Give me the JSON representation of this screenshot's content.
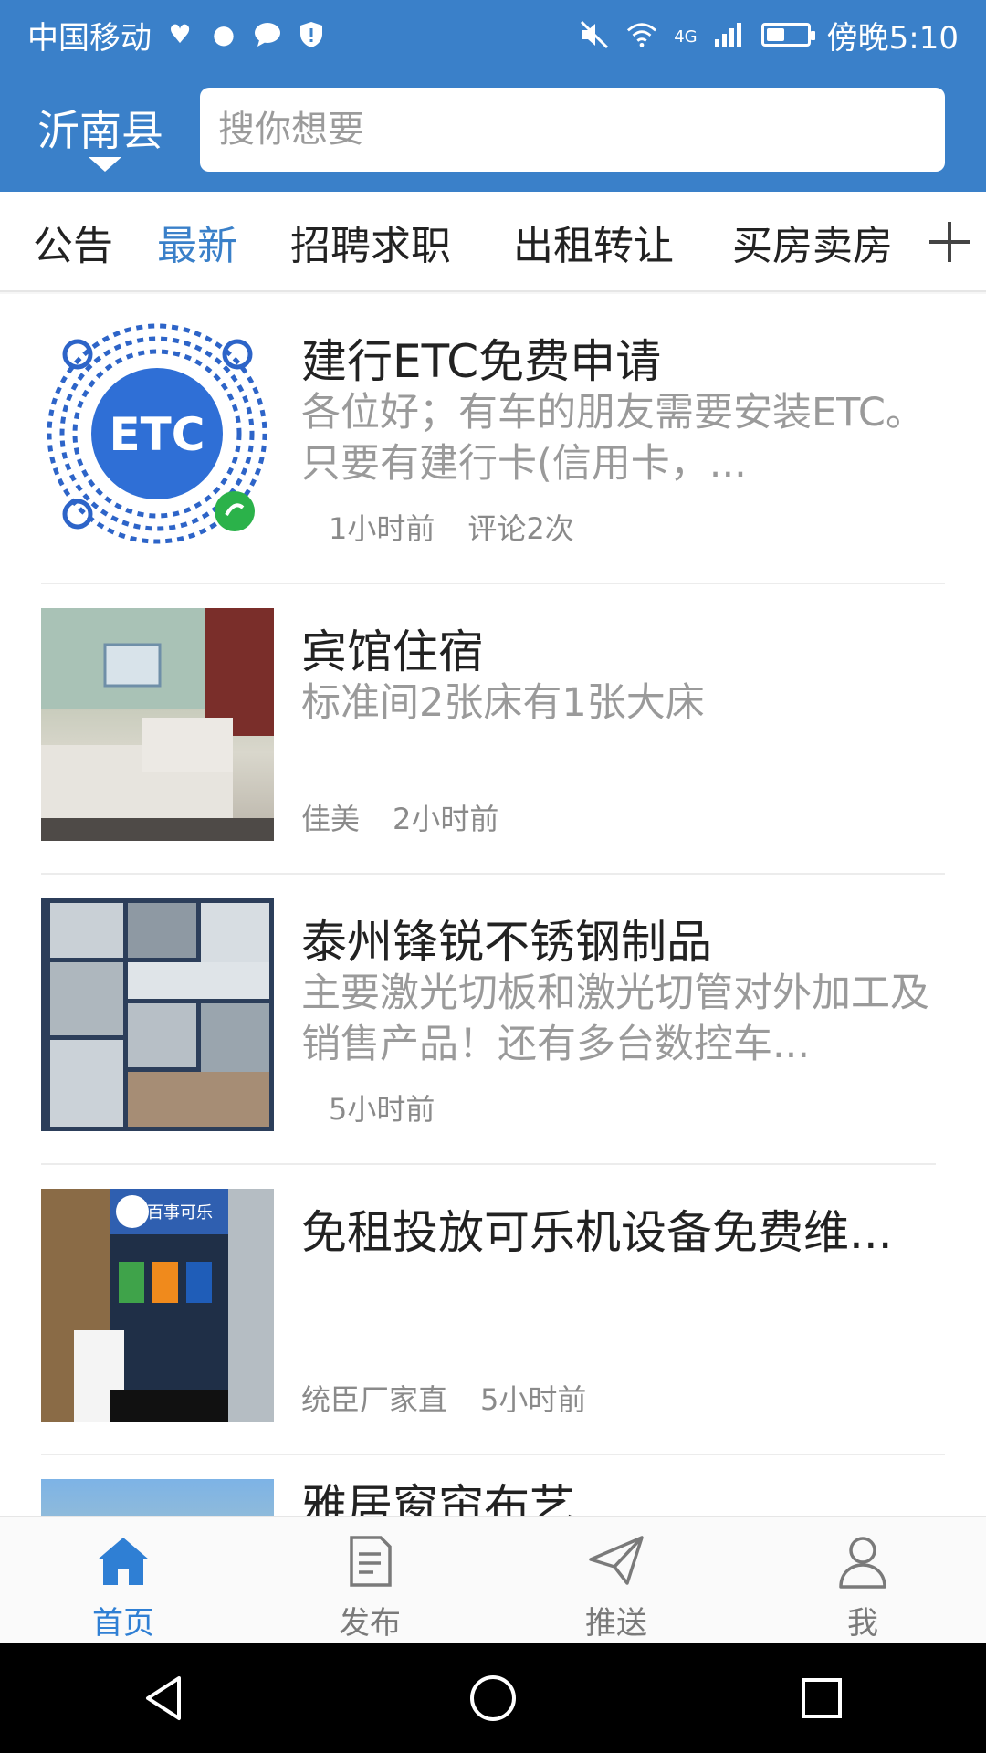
{
  "status_bar": {
    "carrier": "中国移动",
    "network": "4G",
    "time": "傍晚5:10",
    "battery_level": 0.45
  },
  "header": {
    "city": "沂南县",
    "search_placeholder": "搜你想要"
  },
  "tabs": [
    {
      "label": "公告",
      "active": false
    },
    {
      "label": "最新",
      "active": true
    },
    {
      "label": "招聘求职",
      "active": false
    },
    {
      "label": "出租转让",
      "active": false
    },
    {
      "label": "买房卖房",
      "active": false
    }
  ],
  "feed": {
    "items": [
      {
        "title": "建行ETC免费申请",
        "desc": "各位好；有车的朋友需要安装ETC。只要有建行卡(信用卡，...",
        "meta": [
          "1小时前",
          "评论2次"
        ],
        "thumb_label": "ETC"
      },
      {
        "title": "宾馆住宿",
        "desc": "标准间2张床有1张大床",
        "meta": [
          "佳美",
          "2小时前"
        ]
      },
      {
        "title": "泰州锋锐不锈钢制品",
        "desc": "主要激光切板和激光切管对外加工及销售产品！还有多台数控车...",
        "meta": [
          "5小时前"
        ]
      },
      {
        "title": "免租投放可乐机设备免费维...",
        "desc": "",
        "meta": [
          "统臣厂家直",
          "5小时前"
        ],
        "thumb_label": "百事可乐"
      },
      {
        "title": "雅居窗帘布艺",
        "desc": "",
        "meta": []
      }
    ]
  },
  "bottom_nav": [
    {
      "label": "首页",
      "icon": "home-icon",
      "active": true
    },
    {
      "label": "发布",
      "icon": "document-icon",
      "active": false
    },
    {
      "label": "推送",
      "icon": "paper-plane-icon",
      "active": false
    },
    {
      "label": "我",
      "icon": "person-icon",
      "active": false
    }
  ],
  "colors": {
    "header_bg": "#3a80c9",
    "accent": "#2f7fd4"
  }
}
